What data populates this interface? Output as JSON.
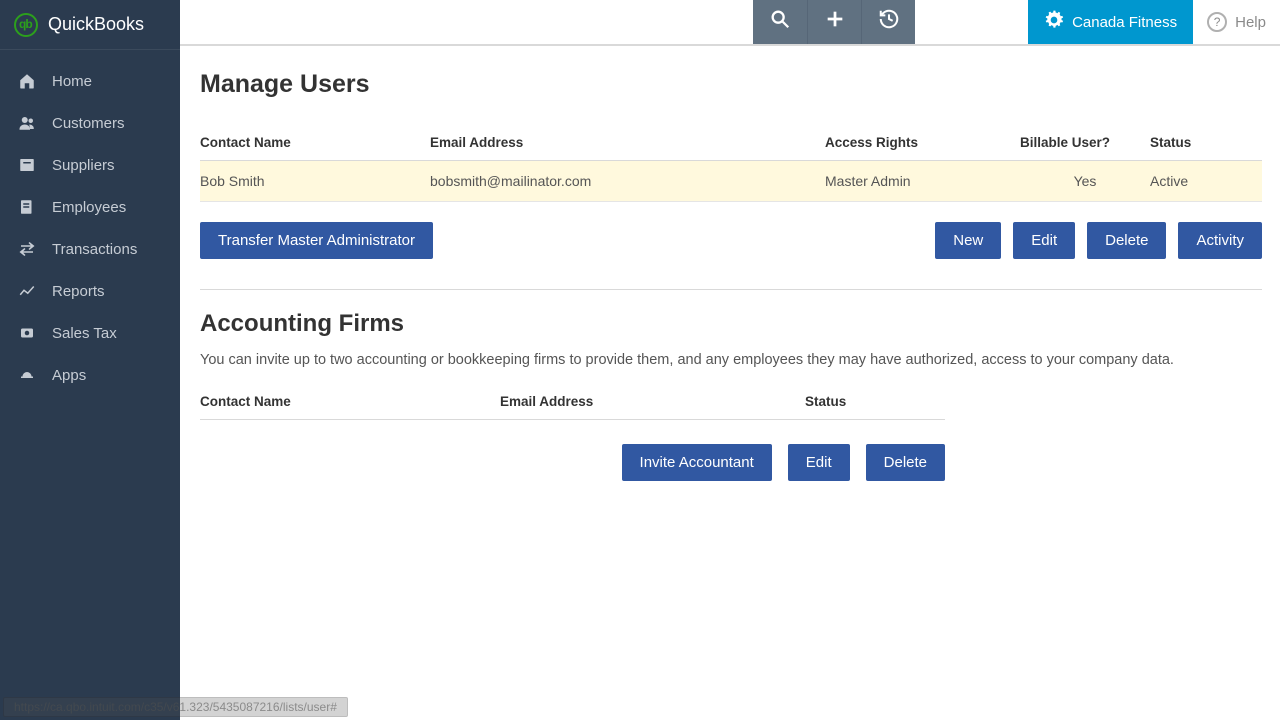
{
  "logo_text": "QuickBooks",
  "sidebar": {
    "items": [
      {
        "label": "Home"
      },
      {
        "label": "Customers"
      },
      {
        "label": "Suppliers"
      },
      {
        "label": "Employees"
      },
      {
        "label": "Transactions"
      },
      {
        "label": "Reports"
      },
      {
        "label": "Sales Tax"
      },
      {
        "label": "Apps"
      }
    ]
  },
  "topbar": {
    "company_name": "Canada Fitness",
    "help_label": "Help"
  },
  "page": {
    "title": "Manage Users",
    "users_table": {
      "headers": {
        "contact_name": "Contact Name",
        "email": "Email Address",
        "access": "Access Rights",
        "billable": "Billable User?",
        "status": "Status"
      },
      "rows": [
        {
          "contact_name": "Bob Smith",
          "email": "bobsmith@mailinator.com",
          "access": "Master Admin",
          "billable": "Yes",
          "status": "Active"
        }
      ]
    },
    "transfer_button": "Transfer Master Administrator",
    "user_actions": {
      "new": "New",
      "edit": "Edit",
      "delete": "Delete",
      "activity": "Activity"
    },
    "firms": {
      "heading": "Accounting Firms",
      "description": "You can invite up to two accounting or bookkeeping firms to provide them, and any employees they may have authorized, access to your company data.",
      "headers": {
        "contact_name": "Contact Name",
        "email": "Email Address",
        "status": "Status"
      },
      "actions": {
        "invite": "Invite Accountant",
        "edit": "Edit",
        "delete": "Delete"
      }
    }
  },
  "status_bar_url": "https://ca.qbo.intuit.com/c35/v61.323/5435087216/lists/user#"
}
